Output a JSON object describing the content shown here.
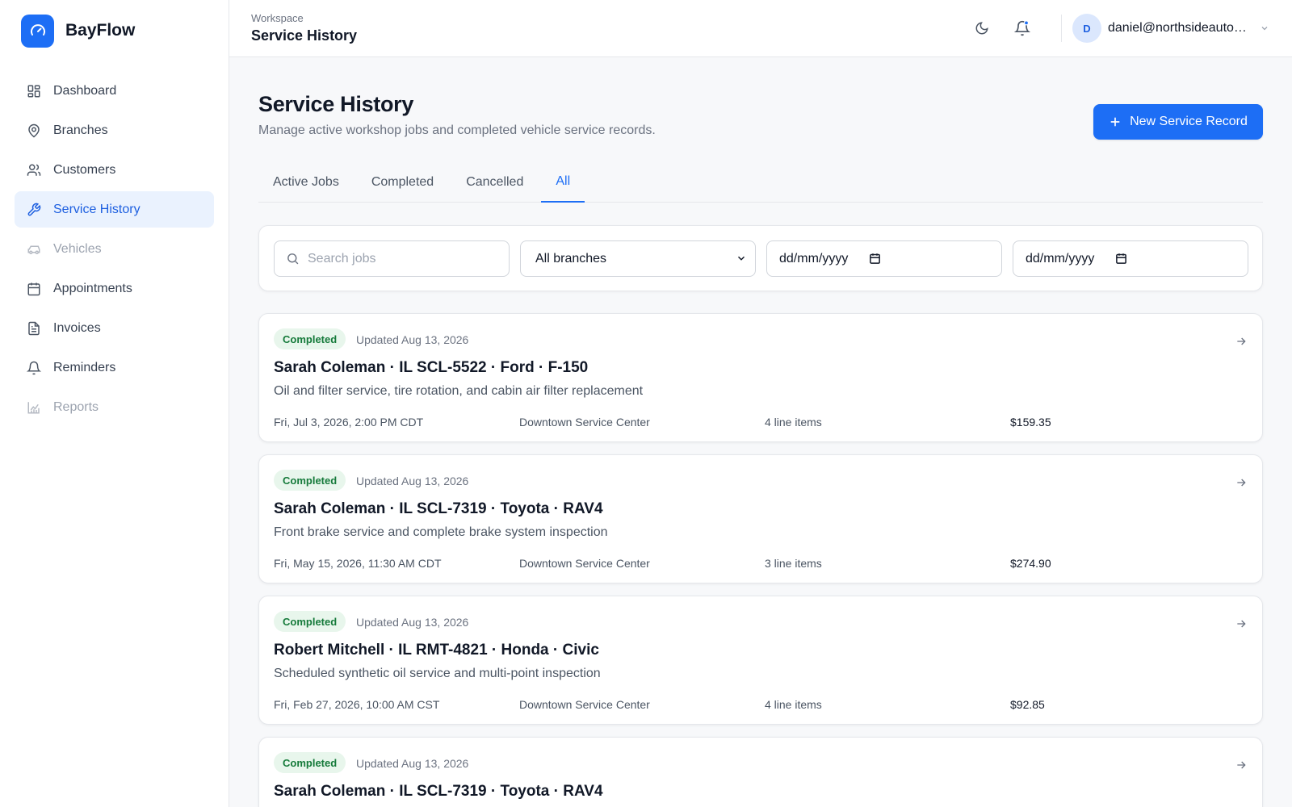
{
  "app": {
    "name": "BayFlow",
    "logo_icon": "gauge-icon",
    "accent": "#1d6ef5"
  },
  "sidebar": {
    "items": [
      {
        "label": "Dashboard",
        "icon": "dashboard-grid-icon",
        "state": "normal"
      },
      {
        "label": "Branches",
        "icon": "map-pin-icon",
        "state": "normal"
      },
      {
        "label": "Customers",
        "icon": "users-icon",
        "state": "normal"
      },
      {
        "label": "Service History",
        "icon": "wrench-icon",
        "state": "active"
      },
      {
        "label": "Vehicles",
        "icon": "car-icon",
        "state": "disabled"
      },
      {
        "label": "Appointments",
        "icon": "calendar-icon",
        "state": "normal"
      },
      {
        "label": "Invoices",
        "icon": "file-text-icon",
        "state": "normal"
      },
      {
        "label": "Reminders",
        "icon": "bell-icon",
        "state": "normal"
      },
      {
        "label": "Reports",
        "icon": "bar-chart-icon",
        "state": "disabled"
      }
    ]
  },
  "header": {
    "breadcrumb_parent": "Workspace",
    "breadcrumb_title": "Service History",
    "user_initial": "D",
    "user_email": "daniel@northsideautoservice.com"
  },
  "page": {
    "title": "Service History",
    "subtitle": "Manage active workshop jobs and completed vehicle service records.",
    "new_button_label": "New Service Record"
  },
  "tabs": [
    {
      "label": "Active Jobs",
      "active": false
    },
    {
      "label": "Completed",
      "active": false
    },
    {
      "label": "Cancelled",
      "active": false
    },
    {
      "label": "All",
      "active": true
    }
  ],
  "filters": {
    "search_placeholder": "Search jobs",
    "branch_selected": "All branches",
    "date_from_placeholder": "dd/mm/yyyy",
    "date_to_placeholder": "dd/mm/yyyy"
  },
  "jobs": [
    {
      "status": "Completed",
      "updated": "Updated Aug 13, 2026",
      "title": "Sarah Coleman · IL SCL-5522 · Ford · F-150",
      "description": "Oil and filter service, tire rotation, and cabin air filter replacement",
      "date": "Fri, Jul 3, 2026, 2:00 PM CDT",
      "branch": "Downtown Service Center",
      "line_items": "4 line items",
      "total": "$159.35"
    },
    {
      "status": "Completed",
      "updated": "Updated Aug 13, 2026",
      "title": "Sarah Coleman · IL SCL-7319 · Toyota · RAV4",
      "description": "Front brake service and complete brake system inspection",
      "date": "Fri, May 15, 2026, 11:30 AM CDT",
      "branch": "Downtown Service Center",
      "line_items": "3 line items",
      "total": "$274.90"
    },
    {
      "status": "Completed",
      "updated": "Updated Aug 13, 2026",
      "title": "Robert Mitchell · IL RMT-4821 · Honda · Civic",
      "description": "Scheduled synthetic oil service and multi-point inspection",
      "date": "Fri, Feb 27, 2026, 10:00 AM CST",
      "branch": "Downtown Service Center",
      "line_items": "4 line items",
      "total": "$92.85"
    },
    {
      "status": "Completed",
      "updated": "Updated Aug 13, 2026",
      "title": "Sarah Coleman · IL SCL-7319 · Toyota · RAV4",
      "description": "",
      "date": "",
      "branch": "",
      "line_items": "",
      "total": ""
    }
  ]
}
